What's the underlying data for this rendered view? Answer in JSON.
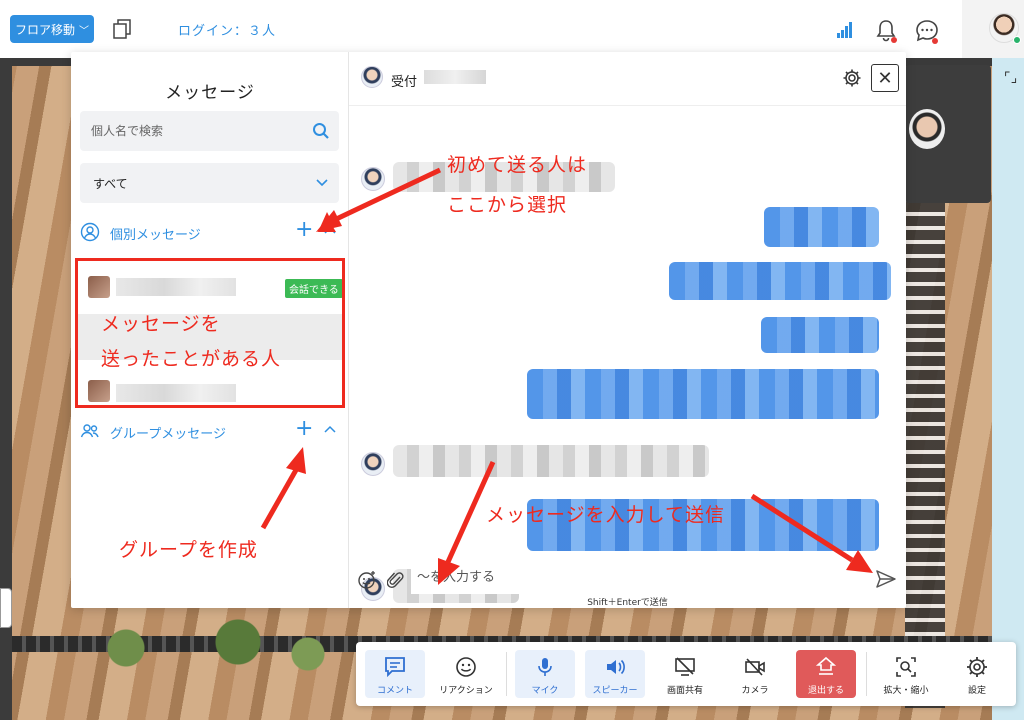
{
  "topbar": {
    "floor_button": "フロア移動",
    "login_label": "ログイン：３人"
  },
  "panel": {
    "title": "メッセージ",
    "search_placeholder": "個人名で検索",
    "filter_value": "すべて",
    "individual_section": "個別メッセージ",
    "group_section": "グループメッセージ",
    "conversation_badge": "会話できる"
  },
  "chat": {
    "header_title": "受付",
    "input_placeholder": "〜を入力する",
    "send_hint": "Shift＋Enterで送信"
  },
  "annotations": {
    "first_send_line1": "初めて送る人は",
    "first_send_line2": "ここから選択",
    "sent_before_line1": "メッセージを",
    "sent_before_line2": "送ったことがある人",
    "create_group": "グループを作成",
    "input_send": "メッセージを入力して送信",
    "color": "#ee2a1f"
  },
  "toolbar": {
    "comment": "コメント",
    "reaction": "リアクション",
    "mic": "マイク",
    "speaker": "スピーカー",
    "screen_share": "画面共有",
    "camera": "カメラ",
    "exit": "退出する",
    "zoom": "拡大・縮小",
    "settings": "設定"
  },
  "colors": {
    "accent": "#2f8fe0",
    "badge": "#3cba55",
    "exit": "#e05a5a"
  }
}
